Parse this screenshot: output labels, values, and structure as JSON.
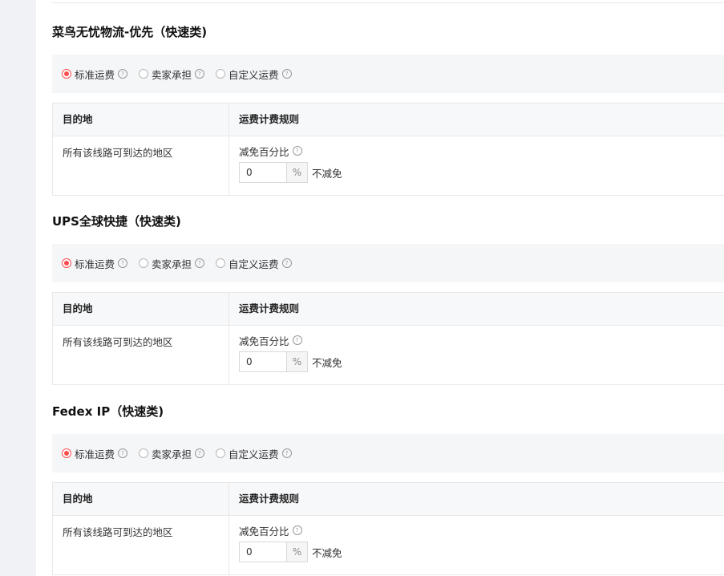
{
  "sections": [
    {
      "title": "菜鸟无忧物流-优先（快速类)",
      "radio_options": [
        "标准运费",
        "卖家承担",
        "自定义运费"
      ],
      "selected_option": "标准运费",
      "table": {
        "headers": [
          "目的地",
          "运费计费规则"
        ],
        "destination": "所有该线路可到达的地区",
        "rule_label": "减免百分比",
        "discount_value": "0",
        "unit": "%",
        "suffix": "不减免"
      }
    },
    {
      "title": "UPS全球快捷（快速类)",
      "radio_options": [
        "标准运费",
        "卖家承担",
        "自定义运费"
      ],
      "selected_option": "标准运费",
      "table": {
        "headers": [
          "目的地",
          "运费计费规则"
        ],
        "destination": "所有该线路可到达的地区",
        "rule_label": "减免百分比",
        "discount_value": "0",
        "unit": "%",
        "suffix": "不减免"
      }
    },
    {
      "title": "Fedex IP（快速类)",
      "radio_options": [
        "标准运费",
        "卖家承担",
        "自定义运费"
      ],
      "selected_option": "标准运费",
      "table": {
        "headers": [
          "目的地",
          "运费计费规则"
        ],
        "destination": "所有该线路可到达的地区",
        "rule_label": "减免百分比",
        "discount_value": "0",
        "unit": "%",
        "suffix": "不减免"
      }
    }
  ],
  "colors": {
    "accent": "#ff4d4f",
    "panel_bg": "#f5f6f8",
    "page_bg": "#f0f2f5"
  }
}
